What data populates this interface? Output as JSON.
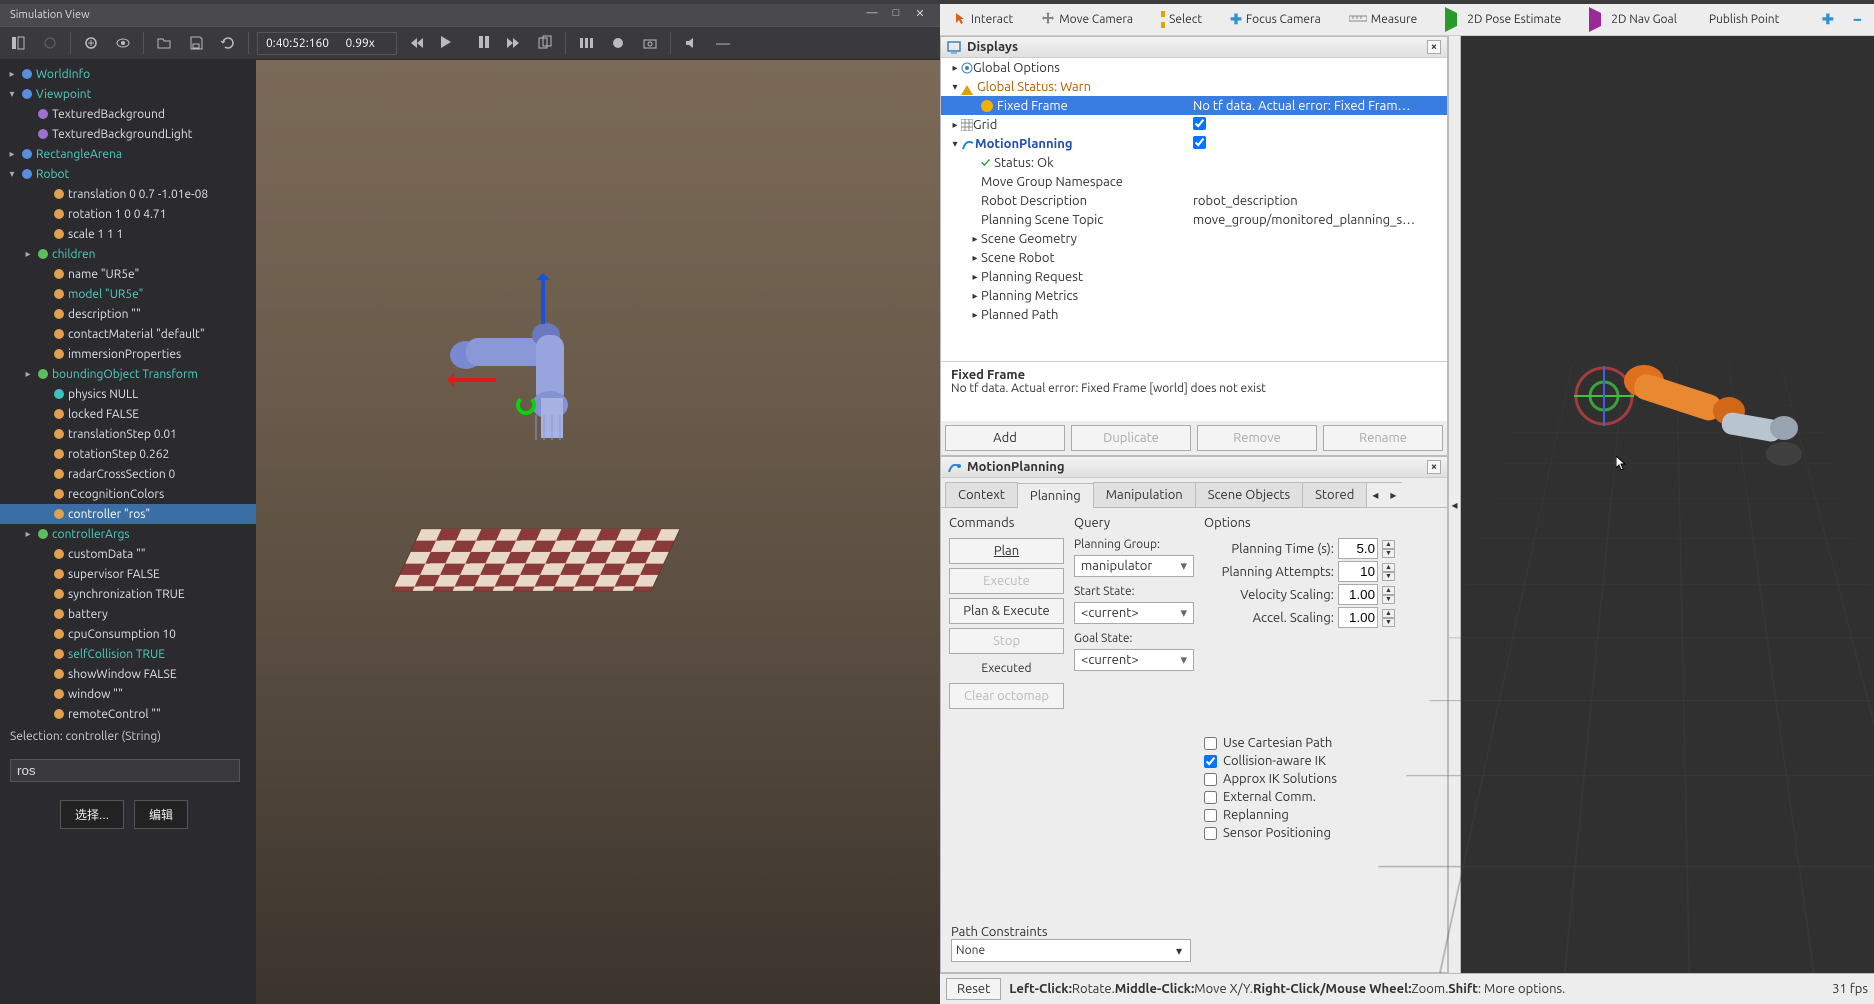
{
  "webots": {
    "title": "Simulation View",
    "time": "0:40:52:160",
    "speed": "0.99x",
    "scene_tree": [
      {
        "ind": 0,
        "exp": "▸",
        "bullet": "bullet-blue",
        "label": "WorldInfo",
        "cls": "teal-txt"
      },
      {
        "ind": 0,
        "exp": "▾",
        "bullet": "bullet-blue",
        "label": "Viewpoint",
        "cls": "teal-txt"
      },
      {
        "ind": 1,
        "exp": "",
        "bullet": "bullet-purple",
        "label": "TexturedBackground",
        "cls": "white-txt"
      },
      {
        "ind": 1,
        "exp": "",
        "bullet": "bullet-purple",
        "label": "TexturedBackgroundLight",
        "cls": "white-txt"
      },
      {
        "ind": 0,
        "exp": "▸",
        "bullet": "bullet-blue",
        "label": "RectangleArena",
        "cls": "teal-txt"
      },
      {
        "ind": 0,
        "exp": "▾",
        "bullet": "bullet-blue",
        "label": "Robot",
        "cls": "teal-txt"
      },
      {
        "ind": 2,
        "exp": "",
        "bullet": "bullet-orange",
        "label": "translation 0 0.7 -1.01e-08",
        "cls": "white-txt"
      },
      {
        "ind": 2,
        "exp": "",
        "bullet": "bullet-orange",
        "label": "rotation 1 0 0 4.71",
        "cls": "white-txt"
      },
      {
        "ind": 2,
        "exp": "",
        "bullet": "bullet-orange",
        "label": "scale 1 1 1",
        "cls": "white-txt"
      },
      {
        "ind": 1,
        "exp": "▸",
        "bullet": "bullet-green",
        "label": "children",
        "cls": "teal-txt"
      },
      {
        "ind": 2,
        "exp": "",
        "bullet": "bullet-orange",
        "label": "name \"UR5e\"",
        "cls": "white-txt"
      },
      {
        "ind": 2,
        "exp": "",
        "bullet": "bullet-orange",
        "label": "model \"UR5e\"",
        "cls": "teal-txt"
      },
      {
        "ind": 2,
        "exp": "",
        "bullet": "bullet-orange",
        "label": "description \"\"",
        "cls": "white-txt"
      },
      {
        "ind": 2,
        "exp": "",
        "bullet": "bullet-orange",
        "label": "contactMaterial \"default\"",
        "cls": "white-txt"
      },
      {
        "ind": 2,
        "exp": "",
        "bullet": "bullet-orange",
        "label": "immersionProperties",
        "cls": "white-txt"
      },
      {
        "ind": 1,
        "exp": "▸",
        "bullet": "bullet-green",
        "label": "boundingObject Transform",
        "cls": "teal-txt"
      },
      {
        "ind": 2,
        "exp": "",
        "bullet": "bullet-teal",
        "label": "physics NULL",
        "cls": "white-txt"
      },
      {
        "ind": 2,
        "exp": "",
        "bullet": "bullet-orange",
        "label": "locked FALSE",
        "cls": "white-txt"
      },
      {
        "ind": 2,
        "exp": "",
        "bullet": "bullet-orange",
        "label": "translationStep 0.01",
        "cls": "white-txt"
      },
      {
        "ind": 2,
        "exp": "",
        "bullet": "bullet-orange",
        "label": "rotationStep 0.262",
        "cls": "white-txt"
      },
      {
        "ind": 2,
        "exp": "",
        "bullet": "bullet-orange",
        "label": "radarCrossSection 0",
        "cls": "white-txt"
      },
      {
        "ind": 2,
        "exp": "",
        "bullet": "bullet-orange",
        "label": "recognitionColors",
        "cls": "white-txt"
      },
      {
        "ind": 2,
        "exp": "",
        "bullet": "bullet-orange",
        "label": "controller \"ros\"",
        "cls": "white-txt",
        "sel": true
      },
      {
        "ind": 1,
        "exp": "▸",
        "bullet": "bullet-green",
        "label": "controllerArgs",
        "cls": "teal-txt"
      },
      {
        "ind": 2,
        "exp": "",
        "bullet": "bullet-orange",
        "label": "customData \"\"",
        "cls": "white-txt"
      },
      {
        "ind": 2,
        "exp": "",
        "bullet": "bullet-orange",
        "label": "supervisor FALSE",
        "cls": "white-txt"
      },
      {
        "ind": 2,
        "exp": "",
        "bullet": "bullet-orange",
        "label": "synchronization TRUE",
        "cls": "white-txt"
      },
      {
        "ind": 2,
        "exp": "",
        "bullet": "bullet-orange",
        "label": "battery",
        "cls": "white-txt"
      },
      {
        "ind": 2,
        "exp": "",
        "bullet": "bullet-orange",
        "label": "cpuConsumption 10",
        "cls": "white-txt"
      },
      {
        "ind": 2,
        "exp": "",
        "bullet": "bullet-orange",
        "label": "selfCollision TRUE",
        "cls": "teal-txt"
      },
      {
        "ind": 2,
        "exp": "",
        "bullet": "bullet-orange",
        "label": "showWindow FALSE",
        "cls": "white-txt"
      },
      {
        "ind": 2,
        "exp": "",
        "bullet": "bullet-orange",
        "label": "window \"\"",
        "cls": "white-txt"
      },
      {
        "ind": 2,
        "exp": "",
        "bullet": "bullet-orange",
        "label": "remoteControl \"\"",
        "cls": "white-txt"
      }
    ],
    "selection_label": "Selection: controller (String)",
    "field_value": "ros",
    "btn_select": "选择...",
    "btn_edit": "编辑"
  },
  "rviz": {
    "tools": [
      {
        "icon": "interact",
        "label": "Interact"
      },
      {
        "icon": "move",
        "label": "Move Camera"
      },
      {
        "icon": "select",
        "label": "Select"
      },
      {
        "icon": "focus",
        "label": "Focus Camera"
      },
      {
        "icon": "measure",
        "label": "Measure"
      },
      {
        "icon": "pose",
        "label": "2D Pose Estimate"
      },
      {
        "icon": "nav",
        "label": "2D Nav Goal"
      },
      {
        "icon": "pub",
        "label": "Publish Point"
      }
    ],
    "displays_title": "Displays",
    "displays": [
      {
        "ind": 0,
        "exp": "▸",
        "label": "Global Options",
        "val": ""
      },
      {
        "ind": 0,
        "exp": "▾",
        "label": "Global Status: Warn",
        "val": "",
        "warn": true
      },
      {
        "ind": 1,
        "exp": "",
        "label": "Fixed Frame",
        "val": "No tf data.  Actual error: Fixed Fram…",
        "sel": true,
        "warn": true
      },
      {
        "ind": 0,
        "exp": "▸",
        "label": "Grid",
        "val": "",
        "check": true
      },
      {
        "ind": 0,
        "exp": "▾",
        "label": "MotionPlanning",
        "val": "",
        "check": true,
        "bold": true,
        "blue": true
      },
      {
        "ind": 1,
        "exp": "",
        "label": "Status: Ok",
        "val": "",
        "ok": true
      },
      {
        "ind": 1,
        "exp": "",
        "label": "Move Group Namespace",
        "val": ""
      },
      {
        "ind": 1,
        "exp": "",
        "label": "Robot Description",
        "val": "robot_description"
      },
      {
        "ind": 1,
        "exp": "",
        "label": "Planning Scene Topic",
        "val": "move_group/monitored_planning_s…"
      },
      {
        "ind": 1,
        "exp": "▸",
        "label": "Scene Geometry",
        "val": ""
      },
      {
        "ind": 1,
        "exp": "▸",
        "label": "Scene Robot",
        "val": ""
      },
      {
        "ind": 1,
        "exp": "▸",
        "label": "Planning Request",
        "val": ""
      },
      {
        "ind": 1,
        "exp": "▸",
        "label": "Planning Metrics",
        "val": ""
      },
      {
        "ind": 1,
        "exp": "▸",
        "label": "Planned Path",
        "val": ""
      }
    ],
    "status_title": "Fixed Frame",
    "status_desc": "No tf data. Actual error: Fixed Frame [world] does not exist",
    "panel_btns": {
      "add": "Add",
      "dup": "Duplicate",
      "rem": "Remove",
      "ren": "Rename"
    },
    "mp_title": "MotionPlanning",
    "mp_tabs": [
      "Context",
      "Planning",
      "Manipulation",
      "Scene Objects",
      "Stored"
    ],
    "mp_active_tab": 1,
    "commands": {
      "heading": "Commands",
      "plan": "Plan",
      "execute": "Execute",
      "plan_execute": "Plan & Execute",
      "stop": "Stop",
      "executed": "Executed",
      "clear": "Clear octomap"
    },
    "query": {
      "heading": "Query",
      "planning_group": "Planning Group:",
      "group_val": "manipulator",
      "start_state": "Start State:",
      "start_val": "<current>",
      "goal_state": "Goal State:",
      "goal_val": "<current>"
    },
    "options": {
      "heading": "Options",
      "rows": [
        {
          "label": "Planning Time (s):",
          "val": "5.0"
        },
        {
          "label": "Planning Attempts:",
          "val": "10"
        },
        {
          "label": "Velocity Scaling:",
          "val": "1.00"
        },
        {
          "label": "Accel. Scaling:",
          "val": "1.00"
        }
      ],
      "checks": [
        {
          "label": "Use Cartesian Path",
          "on": false
        },
        {
          "label": "Collision-aware IK",
          "on": true
        },
        {
          "label": "Approx IK Solutions",
          "on": false
        },
        {
          "label": "External Comm.",
          "on": false
        },
        {
          "label": "Replanning",
          "on": false
        },
        {
          "label": "Sensor Positioning",
          "on": false
        }
      ]
    },
    "path_constraints": {
      "label": "Path Constraints",
      "val": "None"
    },
    "footer": {
      "reset": "Reset",
      "help_left": "Left-Click:",
      "help_left_v": " Rotate. ",
      "help_mid": "Middle-Click:",
      "help_mid_v": " Move X/Y. ",
      "help_right": "Right-Click/Mouse Wheel:",
      "help_right_v": " Zoom. ",
      "help_shift": "Shift",
      "help_shift_v": ": More options.",
      "fps": "31 fps"
    }
  }
}
